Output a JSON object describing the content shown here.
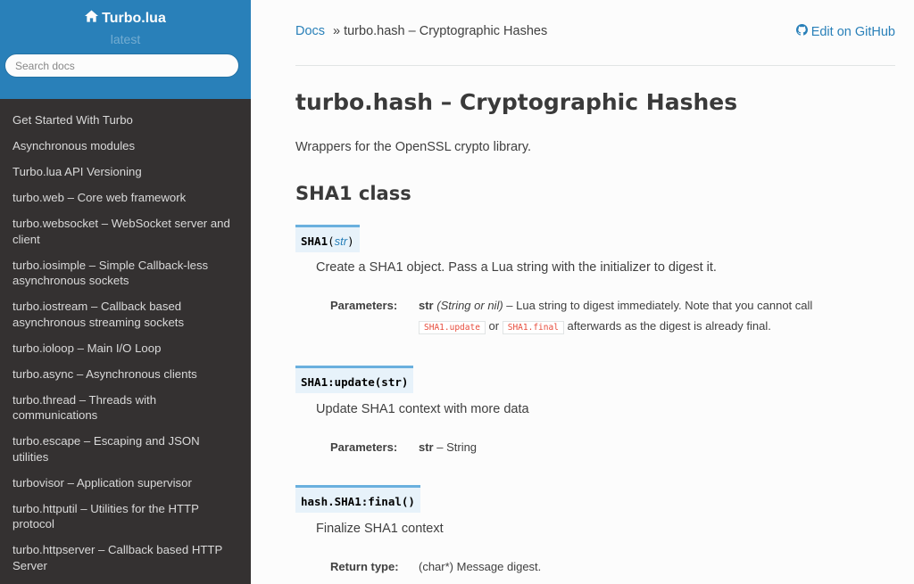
{
  "sidebar": {
    "brand": "Turbo.lua",
    "version": "latest",
    "search_placeholder": "Search docs",
    "nav": [
      "Get Started With Turbo",
      "Asynchronous modules",
      "Turbo.lua API Versioning",
      "turbo.web – Core web framework",
      "turbo.websocket – WebSocket server and client",
      "turbo.iosimple – Simple Callback-less asynchronous sockets",
      "turbo.iostream – Callback based asynchronous streaming sockets",
      "turbo.ioloop – Main I/O Loop",
      "turbo.async – Asynchronous clients",
      "turbo.thread – Threads with communications",
      "turbo.escape – Escaping and JSON utilities",
      "turbovisor – Application supervisor",
      "turbo.httputil – Utilities for the HTTP protocol",
      "turbo.httpserver – Callback based HTTP Server"
    ]
  },
  "breadcrumbs": {
    "docs": "Docs",
    "current": "» turbo.hash – Cryptographic Hashes",
    "edit": "Edit on GitHub"
  },
  "page": {
    "title": "turbo.hash – Cryptographic Hashes",
    "intro": "Wrappers for the OpenSSL crypto library.",
    "section": "SHA1 class"
  },
  "entries": {
    "sha1": {
      "name": "SHA1",
      "open": "(",
      "param": "str",
      "close": ")",
      "desc": "Create a SHA1 object. Pass a Lua string with the initializer to digest it.",
      "field_label": "Parameters:",
      "field_param": "str",
      "field_type": "(String or nil)",
      "field_text1": " – Lua string to digest immediately. Note that you cannot call",
      "code1": "SHA1.update",
      "or": " or ",
      "code2": "SHA1.final",
      "field_text2": " afterwards as the digest is already final."
    },
    "update": {
      "sig": "SHA1:update(str)",
      "desc": "Update SHA1 context with more data",
      "field_label": "Parameters:",
      "field_param": "str",
      "field_text": " – String"
    },
    "final": {
      "sig": "hash.SHA1:final()",
      "desc": "Finalize SHA1 context",
      "field_label": "Return type:",
      "field_text": "(char*) Message digest."
    }
  }
}
